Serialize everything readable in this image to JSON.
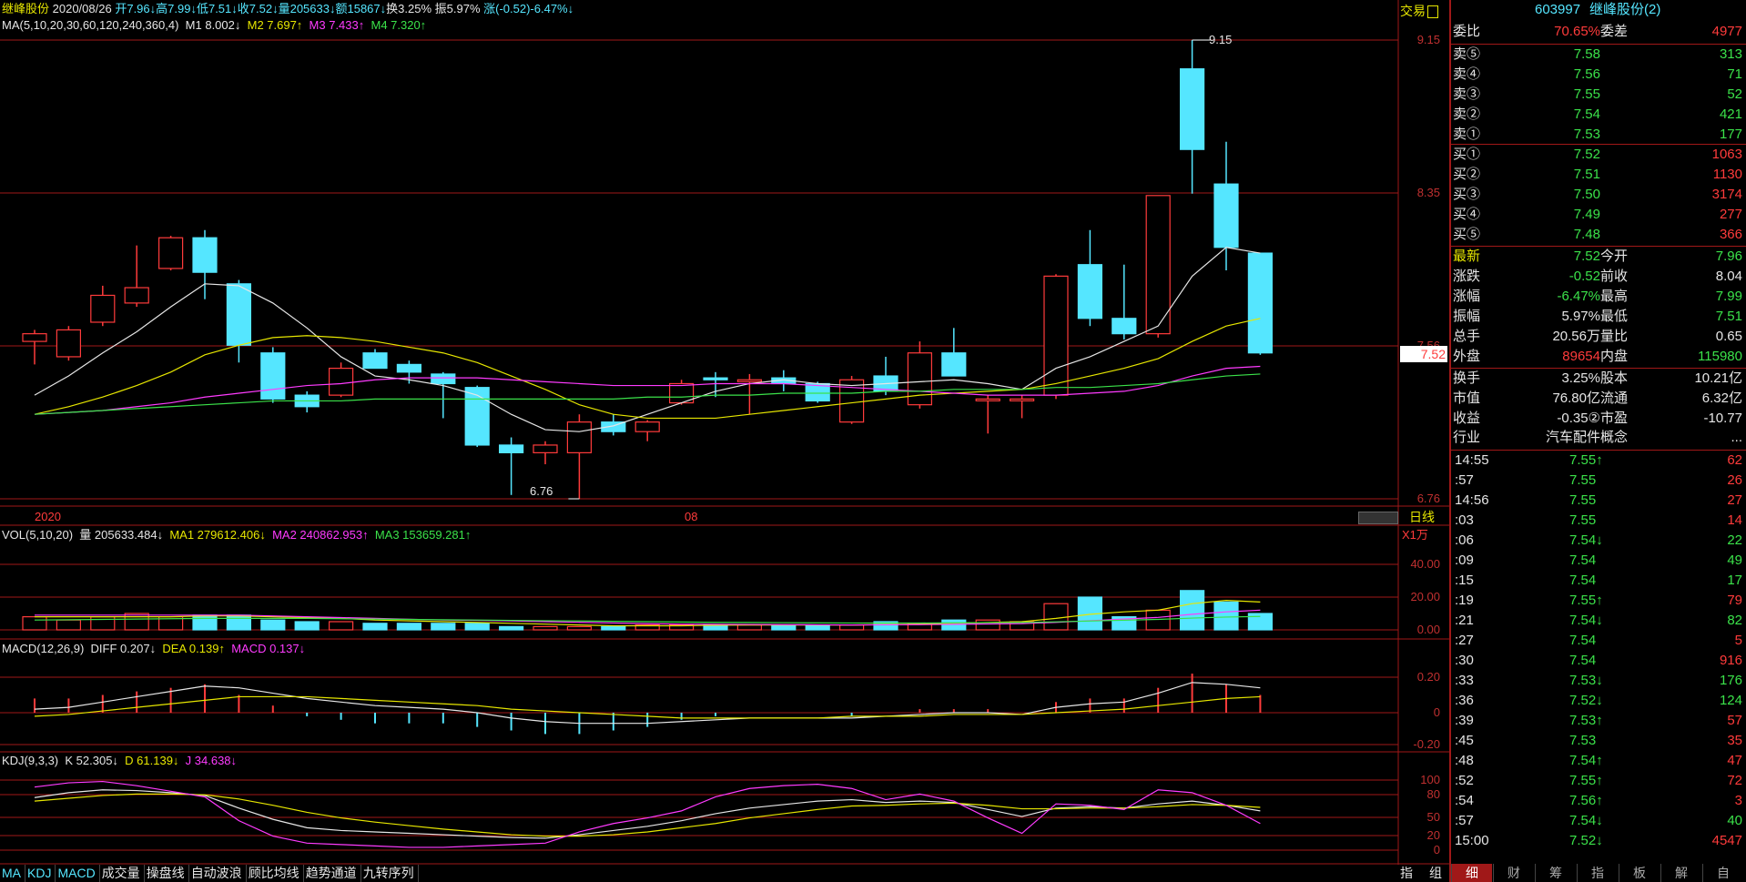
{
  "colors": {
    "up": "#ff3b3b",
    "down": "#55e6ff",
    "grid": "#a01818",
    "ma1": "#e6e6e6",
    "ma2": "#e6e600",
    "ma3": "#ff3bff",
    "ma4": "#3be24a"
  },
  "header": {
    "stock_name": "继峰股份",
    "date": "2020/08/26",
    "open": "开7.96↓",
    "high": "高7.99↓",
    "low": "低7.51↓",
    "close": "收7.52↓",
    "volume": "量205633↓",
    "amount": "额15867↓",
    "turnover": "换3.25%",
    "amplitude": "振5.97%",
    "change": "涨(-0.52)-6.47%↓"
  },
  "ma_legend": {
    "label": "MA(5,10,20,30,60,120,240,360,4)",
    "m1": "M1 8.002↓",
    "m2": "M2 7.697↑",
    "m3": "M3 7.433↑",
    "m4": "M4 7.320↑"
  },
  "main_axis": {
    "top": "9.15",
    "mid1": "8.35",
    "mid2": "7.56",
    "bottom": "6.76",
    "current": "7.52",
    "trade_btn": "交易"
  },
  "price_annotations": {
    "high": "9.15",
    "low": "6.76"
  },
  "time_axis": {
    "year": "2020",
    "month": "08",
    "period": "日线"
  },
  "vol_legend": {
    "label": "VOL(5,10,20)",
    "vol": "量 205633.484↓",
    "ma1": "MA1 279612.406↓",
    "ma2": "MA2 240862.953↑",
    "ma3": "MA3 153659.281↑",
    "unit": "X1万"
  },
  "vol_axis": [
    "40.00",
    "20.00",
    "0.00"
  ],
  "macd_legend": {
    "label": "MACD(12,26,9)",
    "diff": "DIFF 0.207↓",
    "dea": "DEA 0.139↑",
    "macd": "MACD 0.137↓"
  },
  "macd_axis": [
    "0.20",
    "0",
    "-0.20"
  ],
  "kdj_legend": {
    "label": "KDJ(9,3,3)",
    "k": "K 52.305↓",
    "d": "D 61.139↓",
    "j": "J 34.638↓"
  },
  "kdj_axis": [
    "100",
    "80",
    "50",
    "20",
    "0"
  ],
  "bottom_tabs": [
    "MA",
    "KDJ",
    "MACD",
    "成交量",
    "操盘线",
    "自动波浪",
    "顾比均线",
    "趋势通道",
    "九转序列"
  ],
  "bottom_right": [
    "指",
    "组"
  ],
  "candles": [
    {
      "o": 7.58,
      "c": 7.62,
      "h": 7.64,
      "l": 7.46
    },
    {
      "o": 7.5,
      "c": 7.64,
      "h": 7.66,
      "l": 7.48
    },
    {
      "o": 7.68,
      "c": 7.82,
      "h": 7.87,
      "l": 7.66
    },
    {
      "o": 7.78,
      "c": 7.86,
      "h": 8.08,
      "l": 7.76
    },
    {
      "o": 7.96,
      "c": 8.12,
      "h": 8.13,
      "l": 7.95
    },
    {
      "o": 8.12,
      "c": 7.94,
      "h": 8.16,
      "l": 7.8
    },
    {
      "o": 7.88,
      "c": 7.56,
      "h": 7.9,
      "l": 7.47
    },
    {
      "o": 7.52,
      "c": 7.28,
      "h": 7.55,
      "l": 7.26
    },
    {
      "o": 7.3,
      "c": 7.24,
      "h": 7.32,
      "l": 7.21
    },
    {
      "o": 7.3,
      "c": 7.44,
      "h": 7.47,
      "l": 7.29
    },
    {
      "o": 7.52,
      "c": 7.44,
      "h": 7.54,
      "l": 7.44
    },
    {
      "o": 7.46,
      "c": 7.42,
      "h": 7.48,
      "l": 7.36
    },
    {
      "o": 7.41,
      "c": 7.36,
      "h": 7.42,
      "l": 7.18
    },
    {
      "o": 7.34,
      "c": 7.04,
      "h": 7.35,
      "l": 7.03
    },
    {
      "o": 7.04,
      "c": 7.0,
      "h": 7.08,
      "l": 6.78
    },
    {
      "o": 7.0,
      "c": 7.04,
      "h": 7.06,
      "l": 6.94
    },
    {
      "o": 7.0,
      "c": 7.16,
      "h": 7.2,
      "l": 6.76
    },
    {
      "o": 7.16,
      "c": 7.11,
      "h": 7.2,
      "l": 7.09
    },
    {
      "o": 7.11,
      "c": 7.16,
      "h": 7.17,
      "l": 7.06
    },
    {
      "o": 7.26,
      "c": 7.36,
      "h": 7.38,
      "l": 7.25
    },
    {
      "o": 7.39,
      "c": 7.38,
      "h": 7.42,
      "l": 7.29
    },
    {
      "o": 7.38,
      "c": 7.38,
      "h": 7.41,
      "l": 7.2
    },
    {
      "o": 7.39,
      "c": 7.36,
      "h": 7.43,
      "l": 7.32
    },
    {
      "o": 7.36,
      "c": 7.27,
      "h": 7.37,
      "l": 7.26
    },
    {
      "o": 7.16,
      "c": 7.38,
      "h": 7.4,
      "l": 7.15
    },
    {
      "o": 7.4,
      "c": 7.32,
      "h": 7.5,
      "l": 7.3
    },
    {
      "o": 7.25,
      "c": 7.52,
      "h": 7.58,
      "l": 7.23
    },
    {
      "o": 7.52,
      "c": 7.4,
      "h": 7.65,
      "l": 7.4
    },
    {
      "o": 7.28,
      "c": 7.28,
      "h": 7.3,
      "l": 7.1
    },
    {
      "o": 7.28,
      "c": 7.28,
      "h": 7.3,
      "l": 7.18
    },
    {
      "o": 7.3,
      "c": 7.92,
      "h": 7.93,
      "l": 7.28
    },
    {
      "o": 7.98,
      "c": 7.7,
      "h": 8.16,
      "l": 7.66
    },
    {
      "o": 7.7,
      "c": 7.62,
      "h": 7.98,
      "l": 7.59
    },
    {
      "o": 7.62,
      "c": 8.34,
      "h": 8.34,
      "l": 7.6
    },
    {
      "o": 9.0,
      "c": 8.58,
      "h": 9.15,
      "l": 8.35
    },
    {
      "o": 8.4,
      "c": 8.07,
      "h": 8.62,
      "l": 7.95
    },
    {
      "o": 8.04,
      "c": 7.52,
      "h": 8.04,
      "l": 7.51
    }
  ],
  "ma_lines": {
    "m1": [
      7.3,
      7.4,
      7.52,
      7.63,
      7.76,
      7.88,
      7.87,
      7.78,
      7.65,
      7.5,
      7.4,
      7.38,
      7.35,
      7.3,
      7.2,
      7.12,
      7.11,
      7.14,
      7.2,
      7.26,
      7.32,
      7.36,
      7.38,
      7.36,
      7.35,
      7.36,
      7.37,
      7.38,
      7.36,
      7.33,
      7.44,
      7.5,
      7.58,
      7.66,
      7.92,
      8.07,
      8.04
    ],
    "m2": [
      7.2,
      7.24,
      7.29,
      7.35,
      7.42,
      7.51,
      7.56,
      7.6,
      7.61,
      7.6,
      7.58,
      7.55,
      7.52,
      7.47,
      7.4,
      7.33,
      7.25,
      7.2,
      7.18,
      7.18,
      7.18,
      7.2,
      7.22,
      7.24,
      7.26,
      7.28,
      7.3,
      7.31,
      7.32,
      7.33,
      7.36,
      7.4,
      7.44,
      7.49,
      7.58,
      7.66,
      7.7
    ],
    "m3": [
      7.2,
      7.21,
      7.22,
      7.24,
      7.26,
      7.29,
      7.31,
      7.33,
      7.35,
      7.36,
      7.38,
      7.39,
      7.39,
      7.39,
      7.38,
      7.37,
      7.36,
      7.35,
      7.35,
      7.35,
      7.36,
      7.36,
      7.36,
      7.35,
      7.34,
      7.33,
      7.32,
      7.31,
      7.3,
      7.3,
      7.3,
      7.31,
      7.32,
      7.35,
      7.4,
      7.44,
      7.45
    ],
    "m4": [
      7.2,
      7.21,
      7.22,
      7.23,
      7.24,
      7.25,
      7.26,
      7.27,
      7.27,
      7.27,
      7.28,
      7.28,
      7.28,
      7.28,
      7.28,
      7.28,
      7.28,
      7.28,
      7.29,
      7.29,
      7.3,
      7.3,
      7.31,
      7.31,
      7.31,
      7.32,
      7.32,
      7.33,
      7.33,
      7.33,
      7.34,
      7.34,
      7.35,
      7.36,
      7.38,
      7.4,
      7.41
    ]
  },
  "volumes": [
    8,
    6,
    8,
    10,
    8,
    9,
    9,
    6,
    5,
    5,
    4,
    4,
    4,
    4,
    2,
    2,
    2,
    2,
    3,
    3,
    3,
    3,
    3,
    3,
    3,
    5,
    4,
    6,
    6,
    5,
    16,
    20,
    8,
    12,
    24,
    17,
    10
  ],
  "vol_ma": {
    "ma1": [
      8,
      8,
      8,
      8,
      8,
      8.5,
      8.5,
      8,
      7.5,
      7,
      6,
      5.5,
      5,
      4.5,
      4,
      3.5,
      3,
      2.5,
      2.5,
      2.5,
      2.8,
      3,
      3,
      3,
      3,
      3.2,
      3.5,
      4,
      4.5,
      5,
      7,
      9.5,
      11,
      12,
      16,
      18,
      17
    ],
    "ma2": [
      9,
      9,
      9,
      9,
      9,
      9,
      9,
      8.5,
      8,
      7.5,
      7,
      6.5,
      6,
      5.8,
      5.5,
      5,
      4.6,
      4.2,
      3.8,
      3.5,
      3.4,
      3.3,
      3.2,
      3.1,
      3.0,
      3.1,
      3.2,
      3.4,
      3.6,
      3.8,
      4.6,
      5.6,
      6.6,
      7.6,
      9.5,
      11,
      12
    ],
    "ma3": [
      6,
      6.2,
      6.4,
      6.6,
      6.8,
      7,
      7,
      7,
      7,
      6.8,
      6.6,
      6.4,
      6.2,
      6,
      5.8,
      5.6,
      5.4,
      5.2,
      5,
      4.8,
      4.6,
      4.5,
      4.4,
      4.3,
      4.2,
      4.2,
      4.2,
      4.3,
      4.4,
      4.5,
      4.9,
      5.4,
      5.9,
      6.4,
      7.2,
      7.8,
      8.2
    ]
  },
  "macd": {
    "diff": [
      0.02,
      0.03,
      0.06,
      0.09,
      0.12,
      0.15,
      0.14,
      0.11,
      0.08,
      0.06,
      0.04,
      0.03,
      0.02,
      0.0,
      -0.03,
      -0.05,
      -0.06,
      -0.06,
      -0.06,
      -0.05,
      -0.04,
      -0.03,
      -0.03,
      -0.03,
      -0.03,
      -0.02,
      -0.01,
      0.0,
      0.0,
      -0.01,
      0.03,
      0.05,
      0.06,
      0.11,
      0.17,
      0.16,
      0.14
    ],
    "dea": [
      -0.02,
      -0.01,
      0.01,
      0.03,
      0.05,
      0.07,
      0.09,
      0.09,
      0.09,
      0.08,
      0.07,
      0.06,
      0.05,
      0.04,
      0.02,
      0.01,
      0.0,
      -0.01,
      -0.02,
      -0.03,
      -0.03,
      -0.03,
      -0.03,
      -0.03,
      -0.02,
      -0.02,
      -0.02,
      -0.01,
      -0.01,
      -0.01,
      0.0,
      0.01,
      0.02,
      0.04,
      0.06,
      0.08,
      0.09
    ]
  },
  "kdj": {
    "k": [
      75,
      82,
      86,
      85,
      82,
      78,
      60,
      44,
      32,
      28,
      26,
      24,
      22,
      20,
      18,
      17,
      22,
      28,
      34,
      42,
      52,
      60,
      65,
      70,
      72,
      68,
      70,
      68,
      58,
      48,
      60,
      62,
      60,
      66,
      70,
      64,
      56
    ],
    "d": [
      70,
      74,
      78,
      80,
      80,
      79,
      73,
      64,
      54,
      46,
      40,
      35,
      30,
      26,
      22,
      20,
      20,
      22,
      26,
      32,
      38,
      46,
      52,
      58,
      63,
      64,
      66,
      67,
      64,
      59,
      59,
      60,
      60,
      62,
      65,
      64,
      61
    ],
    "j": [
      90,
      96,
      98,
      92,
      84,
      76,
      42,
      20,
      10,
      8,
      6,
      4,
      4,
      6,
      8,
      10,
      26,
      38,
      46,
      56,
      76,
      88,
      92,
      94,
      88,
      72,
      80,
      70,
      46,
      24,
      66,
      64,
      58,
      86,
      82,
      64,
      38
    ]
  },
  "quote": {
    "code": "603997",
    "name": "继峰股份(2)",
    "wb_label": "委比",
    "wb": "70.65%",
    "wc_label": "委差",
    "wc": "4977",
    "asks": [
      {
        "label": "卖⑤",
        "price": "7.58",
        "vol": "313"
      },
      {
        "label": "卖④",
        "price": "7.56",
        "vol": "71"
      },
      {
        "label": "卖③",
        "price": "7.55",
        "vol": "52"
      },
      {
        "label": "卖②",
        "price": "7.54",
        "vol": "421"
      },
      {
        "label": "卖①",
        "price": "7.53",
        "vol": "177"
      }
    ],
    "bids": [
      {
        "label": "买①",
        "price": "7.52",
        "vol": "1063"
      },
      {
        "label": "买②",
        "price": "7.51",
        "vol": "1130"
      },
      {
        "label": "买③",
        "price": "7.50",
        "vol": "3174"
      },
      {
        "label": "买④",
        "price": "7.49",
        "vol": "277"
      },
      {
        "label": "买⑤",
        "price": "7.48",
        "vol": "366"
      }
    ],
    "stats": [
      {
        "l1": "最新",
        "v1": "7.52",
        "c1": "green",
        "l2": "今开",
        "v2": "7.96",
        "c2": "green"
      },
      {
        "l1": "涨跌",
        "v1": "-0.52",
        "c1": "green",
        "l2": "前收",
        "v2": "8.04",
        "c2": "white"
      },
      {
        "l1": "涨幅",
        "v1": "-6.47%",
        "c1": "green",
        "l2": "最高",
        "v2": "7.99",
        "c2": "green"
      },
      {
        "l1": "振幅",
        "v1": "5.97%",
        "c1": "white",
        "l2": "最低",
        "v2": "7.51",
        "c2": "green"
      },
      {
        "l1": "总手",
        "v1": "20.56万",
        "c1": "white",
        "l2": "量比",
        "v2": "0.65",
        "c2": "white"
      },
      {
        "l1": "外盘",
        "v1": "89654",
        "c1": "red",
        "l2": "内盘",
        "v2": "115980",
        "c2": "green"
      }
    ],
    "info": [
      {
        "l1": "换手",
        "v1": "3.25%",
        "l2": "股本",
        "v2": "10.21亿"
      },
      {
        "l1": "市值",
        "v1": "76.80亿",
        "l2": "流通",
        "v2": "6.32亿"
      },
      {
        "l1": "收益",
        "v1": "-0.35②",
        "l2": "市盈",
        "v2": "-10.77"
      }
    ],
    "industry_label": "行业",
    "industry": "汽车配件",
    "concept_label": "概念",
    "concept": "..."
  },
  "ticks": [
    {
      "t": "14:55",
      "p": "7.55↑",
      "v": "62",
      "vc": "red"
    },
    {
      "t": ":57",
      "p": "7.55",
      "v": "26",
      "vc": "red"
    },
    {
      "t": "14:56",
      "p": "7.55",
      "v": "27",
      "vc": "red"
    },
    {
      "t": ":03",
      "p": "7.55",
      "v": "14",
      "vc": "red"
    },
    {
      "t": ":06",
      "p": "7.54↓",
      "v": "22",
      "vc": "green"
    },
    {
      "t": ":09",
      "p": "7.54",
      "v": "49",
      "vc": "green"
    },
    {
      "t": ":15",
      "p": "7.54",
      "v": "17",
      "vc": "green"
    },
    {
      "t": ":19",
      "p": "7.55↑",
      "v": "79",
      "vc": "red"
    },
    {
      "t": ":21",
      "p": "7.54↓",
      "v": "82",
      "vc": "green"
    },
    {
      "t": ":27",
      "p": "7.54",
      "v": "5",
      "vc": "red"
    },
    {
      "t": ":30",
      "p": "7.54",
      "v": "916",
      "vc": "red"
    },
    {
      "t": ":33",
      "p": "7.53↓",
      "v": "176",
      "vc": "green"
    },
    {
      "t": ":36",
      "p": "7.52↓",
      "v": "124",
      "vc": "green"
    },
    {
      "t": ":39",
      "p": "7.53↑",
      "v": "57",
      "vc": "red"
    },
    {
      "t": ":45",
      "p": "7.53",
      "v": "35",
      "vc": "red"
    },
    {
      "t": ":48",
      "p": "7.54↑",
      "v": "47",
      "vc": "red"
    },
    {
      "t": ":52",
      "p": "7.55↑",
      "v": "72",
      "vc": "red"
    },
    {
      "t": ":54",
      "p": "7.56↑",
      "v": "3",
      "vc": "red"
    },
    {
      "t": ":57",
      "p": "7.54↓",
      "v": "40",
      "vc": "green"
    },
    {
      "t": "15:00",
      "p": "7.52↓",
      "v": "4547",
      "vc": "red"
    }
  ],
  "right_tabs": [
    "细",
    "财",
    "筹",
    "指",
    "板",
    "解",
    "自"
  ]
}
